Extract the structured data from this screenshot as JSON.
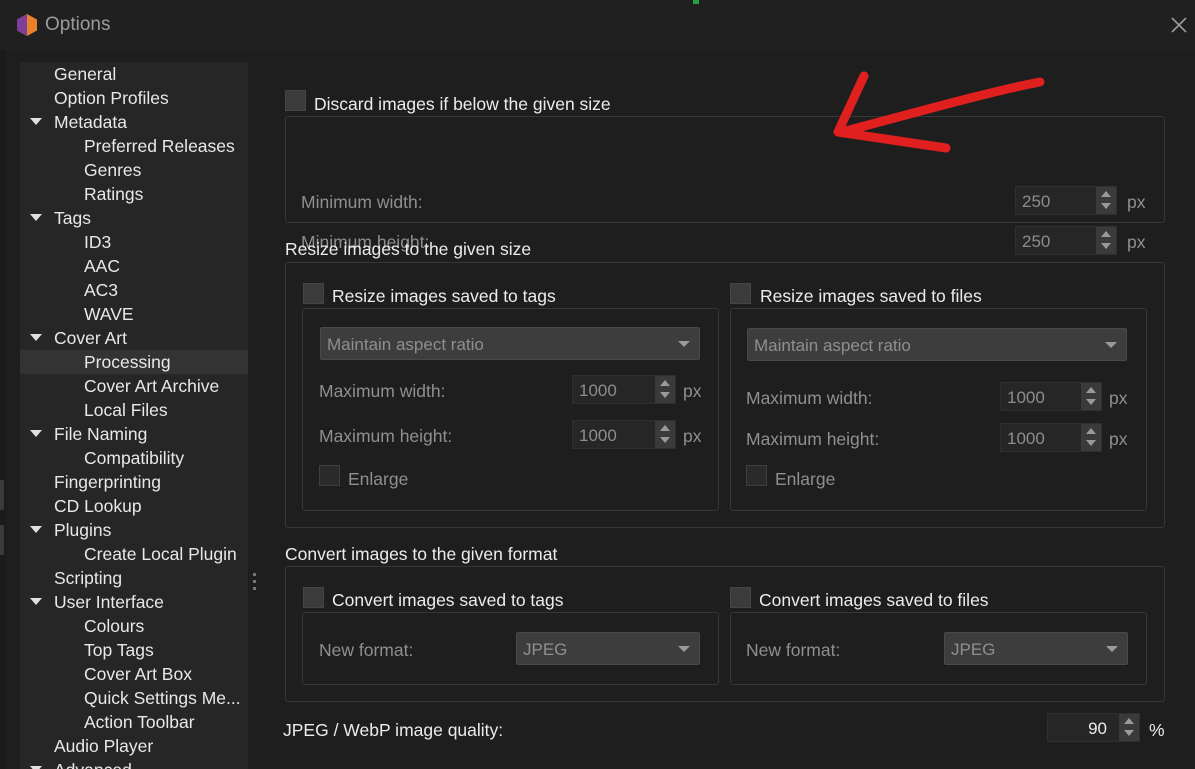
{
  "window": {
    "title": "Options"
  },
  "sidebar": {
    "items": [
      {
        "label": "General",
        "level": 0,
        "expandable": false
      },
      {
        "label": "Option Profiles",
        "level": 0,
        "expandable": false
      },
      {
        "label": "Metadata",
        "level": 0,
        "expandable": true
      },
      {
        "label": "Preferred Releases",
        "level": 1,
        "expandable": false
      },
      {
        "label": "Genres",
        "level": 1,
        "expandable": false
      },
      {
        "label": "Ratings",
        "level": 1,
        "expandable": false
      },
      {
        "label": "Tags",
        "level": 0,
        "expandable": true
      },
      {
        "label": "ID3",
        "level": 1,
        "expandable": false
      },
      {
        "label": "AAC",
        "level": 1,
        "expandable": false
      },
      {
        "label": "AC3",
        "level": 1,
        "expandable": false
      },
      {
        "label": "WAVE",
        "level": 1,
        "expandable": false
      },
      {
        "label": "Cover Art",
        "level": 0,
        "expandable": true
      },
      {
        "label": "Processing",
        "level": 1,
        "expandable": false,
        "selected": true
      },
      {
        "label": "Cover Art Archive",
        "level": 1,
        "expandable": false
      },
      {
        "label": "Local Files",
        "level": 1,
        "expandable": false
      },
      {
        "label": "File Naming",
        "level": 0,
        "expandable": true
      },
      {
        "label": "Compatibility",
        "level": 1,
        "expandable": false
      },
      {
        "label": "Fingerprinting",
        "level": 0,
        "expandable": false
      },
      {
        "label": "CD Lookup",
        "level": 0,
        "expandable": false
      },
      {
        "label": "Plugins",
        "level": 0,
        "expandable": true
      },
      {
        "label": "Create Local Plugin",
        "level": 1,
        "expandable": false
      },
      {
        "label": "Scripting",
        "level": 0,
        "expandable": false
      },
      {
        "label": "User Interface",
        "level": 0,
        "expandable": true
      },
      {
        "label": "Colours",
        "level": 1,
        "expandable": false
      },
      {
        "label": "Top Tags",
        "level": 1,
        "expandable": false
      },
      {
        "label": "Cover Art Box",
        "level": 1,
        "expandable": false
      },
      {
        "label": "Quick Settings Me...",
        "level": 1,
        "expandable": false
      },
      {
        "label": "Action Toolbar",
        "level": 1,
        "expandable": false
      },
      {
        "label": "Audio Player",
        "level": 0,
        "expandable": false
      },
      {
        "label": "Advanced",
        "level": 0,
        "expandable": true
      }
    ]
  },
  "discard": {
    "checkbox_label": "Discard images if below the given size",
    "min_width_label": "Minimum width:",
    "min_width_value": "250",
    "min_height_label": "Minimum height:",
    "min_height_value": "250",
    "unit": "px"
  },
  "resize": {
    "heading": "Resize images to the given size",
    "tags": {
      "checkbox_label": "Resize images saved to tags",
      "mode": "Maintain aspect ratio",
      "max_width_label": "Maximum width:",
      "max_width_value": "1000",
      "max_height_label": "Maximum height:",
      "max_height_value": "1000",
      "enlarge_label": "Enlarge",
      "unit": "px"
    },
    "files": {
      "checkbox_label": "Resize images saved to files",
      "mode": "Maintain aspect ratio",
      "max_width_label": "Maximum width:",
      "max_width_value": "1000",
      "max_height_label": "Maximum height:",
      "max_height_value": "1000",
      "enlarge_label": "Enlarge",
      "unit": "px"
    }
  },
  "convert": {
    "heading": "Convert images to the given format",
    "tags": {
      "checkbox_label": "Convert images saved to tags",
      "format_label": "New format:",
      "format_value": "JPEG"
    },
    "files": {
      "checkbox_label": "Convert images saved to files",
      "format_label": "New format:",
      "format_value": "JPEG"
    }
  },
  "quality": {
    "label": "JPEG / WebP image quality:",
    "value": "90",
    "unit": "%"
  },
  "colors": {
    "background": "#1e1e1e",
    "sidebar": "#262626",
    "annotation_arrow": "#e0201e",
    "app_icon": "#e8812a"
  }
}
